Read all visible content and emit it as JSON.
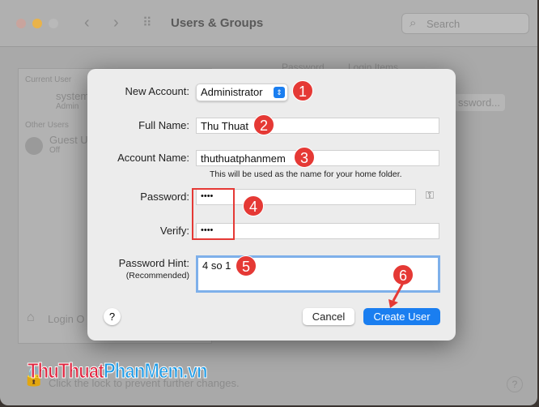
{
  "window": {
    "title": "Users & Groups",
    "search_placeholder": "Search"
  },
  "background": {
    "tabs": [
      "Password",
      "Login Items"
    ],
    "current_user_header": "Current User",
    "user_name": "system",
    "user_role": "Admin",
    "other_users_header": "Other Users",
    "guest_name": "Guest U",
    "guest_status": "Off",
    "login_options": "Login O",
    "change_password": "ssword...",
    "lock_text": "Click the lock to prevent further changes.",
    "help": "?"
  },
  "dialog": {
    "new_account_label": "New Account:",
    "new_account_value": "Administrator",
    "full_name_label": "Full Name:",
    "full_name_value": "Thu Thuat",
    "account_name_label": "Account Name:",
    "account_name_value": "thuthuatphanmem",
    "account_hint": "This will be used as the name for your home folder.",
    "password_label": "Password:",
    "password_value": "••••",
    "verify_label": "Verify:",
    "verify_value": "••••",
    "hint_label": "Password Hint:",
    "hint_sub": "(Recommended)",
    "hint_value": "4 so 1",
    "help": "?",
    "cancel": "Cancel",
    "create": "Create User"
  },
  "annotations": [
    "1",
    "2",
    "3",
    "4",
    "5",
    "6"
  ],
  "watermark": {
    "part1": "ThuThuat",
    "part2": "PhanMem",
    "part3": ".vn"
  },
  "colors": {
    "accent": "#1a7ef0",
    "annotation": "#e53935",
    "watermark_red": "#e0233e",
    "watermark_blue": "#1e9be6"
  }
}
